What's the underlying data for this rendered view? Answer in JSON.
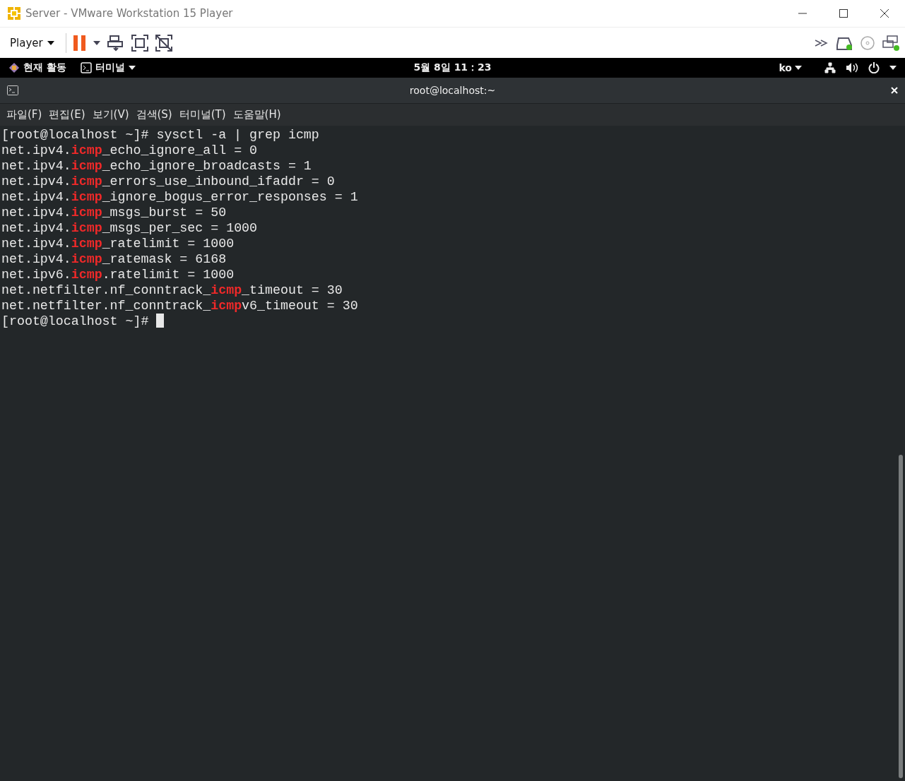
{
  "window": {
    "title": "Server - VMware Workstation 15 Player"
  },
  "toolbar": {
    "player_menu": "Player"
  },
  "top_bar": {
    "activities": "현재 활동",
    "app_menu": "터미널",
    "clock": "5월 8일  11：23",
    "language": "ko"
  },
  "terminal": {
    "title": "root@localhost:~",
    "menu": [
      "파일(F)",
      "편집(E)",
      "보기(V)",
      "검색(S)",
      "터미널(T)",
      "도움말(H)"
    ],
    "lines": [
      [
        {
          "text": "[root@localhost ~]# sysctl -a | grep icmp",
          "match": false
        }
      ],
      [
        {
          "text": "net.ipv4.",
          "match": false
        },
        {
          "text": "icmp",
          "match": true
        },
        {
          "text": "_echo_ignore_all = 0",
          "match": false
        }
      ],
      [
        {
          "text": "net.ipv4.",
          "match": false
        },
        {
          "text": "icmp",
          "match": true
        },
        {
          "text": "_echo_ignore_broadcasts = 1",
          "match": false
        }
      ],
      [
        {
          "text": "net.ipv4.",
          "match": false
        },
        {
          "text": "icmp",
          "match": true
        },
        {
          "text": "_errors_use_inbound_ifaddr = 0",
          "match": false
        }
      ],
      [
        {
          "text": "net.ipv4.",
          "match": false
        },
        {
          "text": "icmp",
          "match": true
        },
        {
          "text": "_ignore_bogus_error_responses = 1",
          "match": false
        }
      ],
      [
        {
          "text": "net.ipv4.",
          "match": false
        },
        {
          "text": "icmp",
          "match": true
        },
        {
          "text": "_msgs_burst = 50",
          "match": false
        }
      ],
      [
        {
          "text": "net.ipv4.",
          "match": false
        },
        {
          "text": "icmp",
          "match": true
        },
        {
          "text": "_msgs_per_sec = 1000",
          "match": false
        }
      ],
      [
        {
          "text": "net.ipv4.",
          "match": false
        },
        {
          "text": "icmp",
          "match": true
        },
        {
          "text": "_ratelimit = 1000",
          "match": false
        }
      ],
      [
        {
          "text": "net.ipv4.",
          "match": false
        },
        {
          "text": "icmp",
          "match": true
        },
        {
          "text": "_ratemask = 6168",
          "match": false
        }
      ],
      [
        {
          "text": "net.ipv6.",
          "match": false
        },
        {
          "text": "icmp",
          "match": true
        },
        {
          "text": ".ratelimit = 1000",
          "match": false
        }
      ],
      [
        {
          "text": "net.netfilter.nf_conntrack_",
          "match": false
        },
        {
          "text": "icmp",
          "match": true
        },
        {
          "text": "_timeout = 30",
          "match": false
        }
      ],
      [
        {
          "text": "net.netfilter.nf_conntrack_",
          "match": false
        },
        {
          "text": "icmp",
          "match": true
        },
        {
          "text": "v6_timeout = 30",
          "match": false
        }
      ]
    ],
    "prompt": "[root@localhost ~]# "
  }
}
